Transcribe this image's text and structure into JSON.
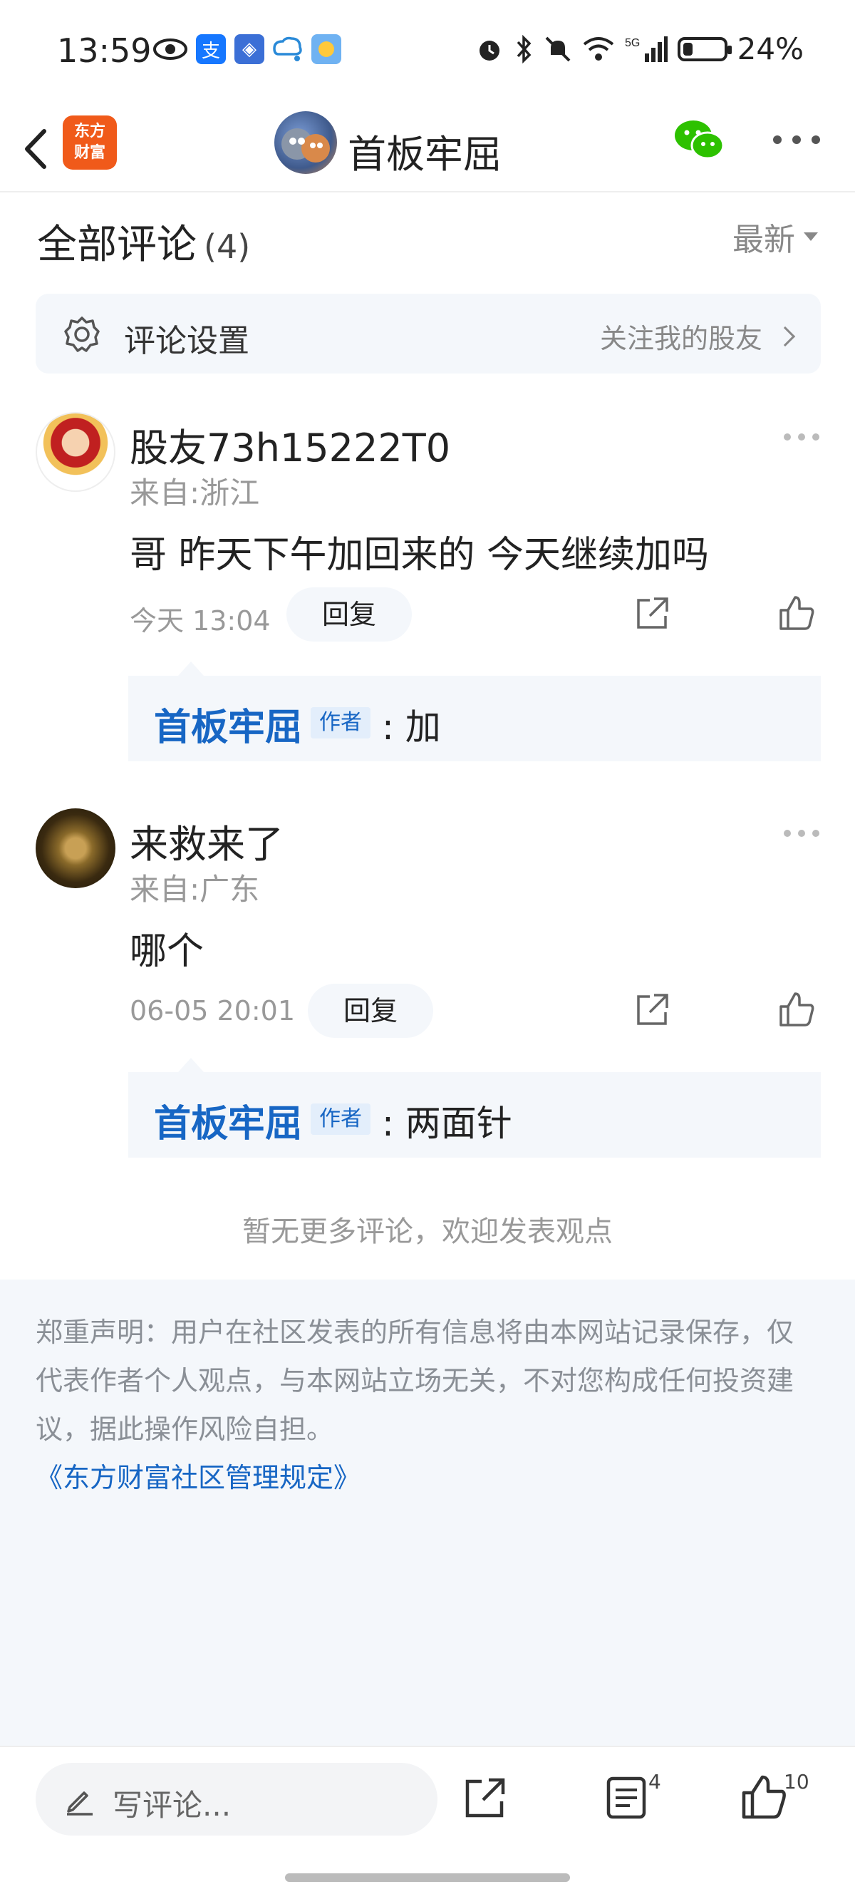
{
  "status_bar": {
    "time": "13:59",
    "battery": "24%",
    "battery_level": 0.24,
    "left_icons": [
      "eye-icon",
      "alipay-icon",
      "app-shield-icon",
      "cloud-chat-icon",
      "weather-icon"
    ],
    "right_icons": [
      "alarm-icon",
      "bluetooth-icon",
      "mute-icon",
      "wifi-icon",
      "5g-signal-icon",
      "battery-icon"
    ]
  },
  "nav": {
    "logo_line1": "东方",
    "logo_line2": "财富",
    "title": "首板牢屈"
  },
  "comments_header": {
    "title": "全部评论",
    "count": "(4)",
    "sort": "最新"
  },
  "settings": {
    "label": "评论设置",
    "right_text": "关注我的股友"
  },
  "comments": [
    {
      "user": "股友73h15222T0",
      "location": "来自:浙江",
      "text": "哥 昨天下午加回来的 今天继续加吗",
      "time": "今天 13:04",
      "reply_label": "回复",
      "reply": {
        "author": "首板牢屈",
        "tag": "作者",
        "text": ": 加"
      }
    },
    {
      "user": "来救来了",
      "location": "来自:广东",
      "text": "哪个",
      "time": "06-05 20:01",
      "reply_label": "回复",
      "reply": {
        "author": "首板牢屈",
        "tag": "作者",
        "text": ": 两面针"
      }
    }
  ],
  "no_more": "暂无更多评论，欢迎发表观点",
  "disclaimer": {
    "line1": "郑重声明：用户在社区发表的所有信息将由本网站记录保存，仅",
    "line2": "代表作者个人观点，与本网站立场无关，不对您构成任何投资建",
    "line3": "议，据此操作风险自担。",
    "link": "《东方财富社区管理规定》"
  },
  "bottom_bar": {
    "placeholder": "写评论...",
    "comment_count": "4",
    "like_count": "10"
  }
}
